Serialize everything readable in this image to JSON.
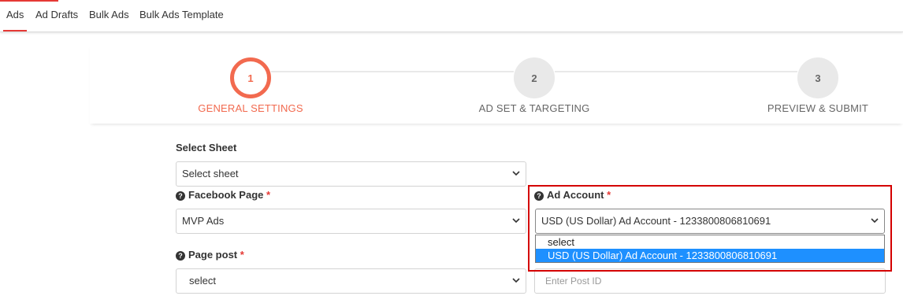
{
  "colors": {
    "accent": "#e53935",
    "step_active": "#f26a4f",
    "highlight": "#d40000",
    "option_selected": "#1e90ff"
  },
  "tabs": [
    {
      "label": "Ads",
      "active": true
    },
    {
      "label": "Ad Drafts"
    },
    {
      "label": "Bulk Ads"
    },
    {
      "label": "Bulk Ads Template"
    }
  ],
  "stepper": {
    "steps": [
      {
        "number": "1",
        "label": "GENERAL SETTINGS",
        "active": true
      },
      {
        "number": "2",
        "label": "AD SET & TARGETING"
      },
      {
        "number": "3",
        "label": "PREVIEW & SUBMIT"
      }
    ]
  },
  "form": {
    "select_sheet": {
      "label": "Select Sheet",
      "value": "Select sheet"
    },
    "facebook_page": {
      "label": "Facebook Page",
      "required": "*",
      "value": "MVP Ads",
      "icon": "question-circle-icon"
    },
    "ad_account": {
      "label": "Ad Account",
      "required": "*",
      "icon": "question-circle-icon",
      "value": "USD (US Dollar) Ad Account - 1233800806810691",
      "options": [
        "select",
        "USD (US Dollar) Ad Account - 1233800806810691"
      ]
    },
    "page_post": {
      "label": "Page post",
      "required": "*",
      "value": "select",
      "icon": "question-circle-icon"
    },
    "post_id": {
      "placeholder": "Enter Post ID"
    }
  }
}
